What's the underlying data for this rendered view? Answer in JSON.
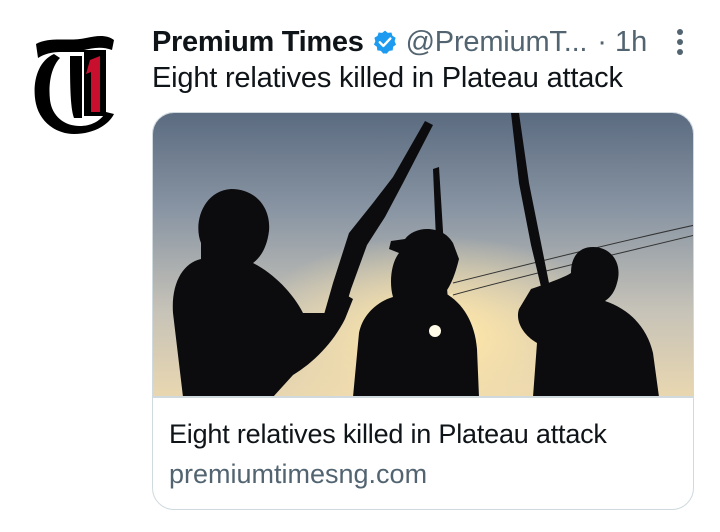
{
  "tweet": {
    "author_name": "Premium Times",
    "author_handle": "@PremiumT...",
    "separator": "·",
    "time": "1h",
    "text": "Eight relatives killed in Plateau attack",
    "verified": true,
    "avatar_logo_letters": "T1",
    "more_icon": "more-vertical-icon"
  },
  "card": {
    "title": "Eight relatives killed in Plateau attack",
    "domain": "premiumtimesng.com"
  },
  "colors": {
    "text_primary": "#0f1419",
    "text_secondary": "#536471",
    "verified_blue": "#1d9bf0",
    "card_border": "#cfd9de",
    "logo_red": "#c8102e"
  }
}
